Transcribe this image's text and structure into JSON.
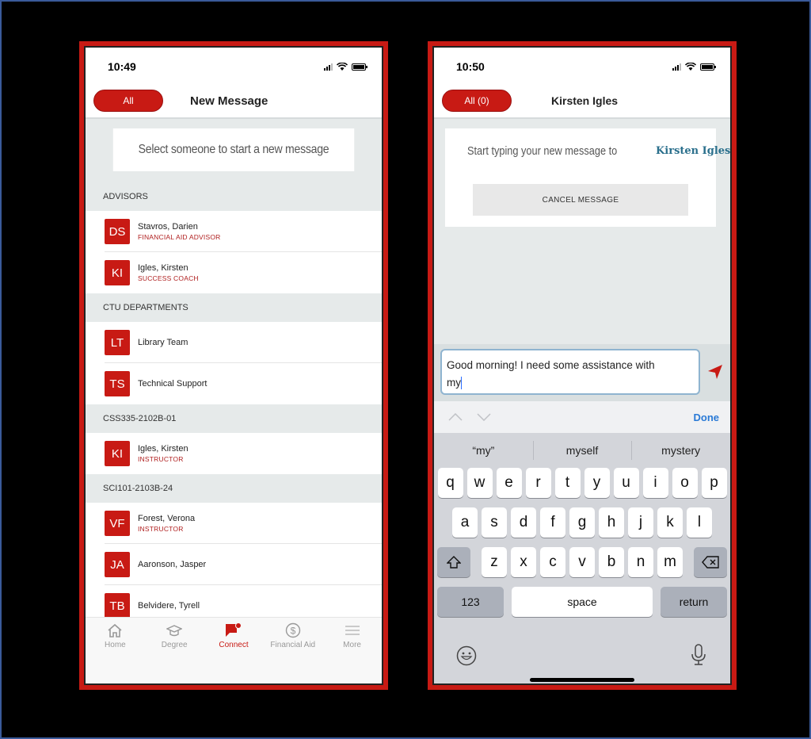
{
  "left_screen": {
    "status": {
      "time": "10:49"
    },
    "header": {
      "pill_label": "All",
      "title": "New Message"
    },
    "prompt": "Select someone to start a new message",
    "sections": [
      {
        "title": "ADVISORS",
        "contacts": [
          {
            "initials": "DS",
            "name": "Stavros, Darien",
            "role": "FINANCIAL AID ADVISOR"
          },
          {
            "initials": "KI",
            "name": "Igles, Kirsten",
            "role": "SUCCESS COACH"
          }
        ]
      },
      {
        "title": "CTU DEPARTMENTS",
        "contacts": [
          {
            "initials": "LT",
            "name": "Library Team",
            "role": ""
          },
          {
            "initials": "TS",
            "name": "Technical Support",
            "role": ""
          }
        ]
      },
      {
        "title": "CSS335-2102B-01",
        "contacts": [
          {
            "initials": "KI",
            "name": "Igles, Kirsten",
            "role": "INSTRUCTOR"
          }
        ]
      },
      {
        "title": "SCI101-2103B-24",
        "contacts": [
          {
            "initials": "VF",
            "name": "Forest, Verona",
            "role": "INSTRUCTOR"
          },
          {
            "initials": "JA",
            "name": "Aaronson, Jasper",
            "role": ""
          },
          {
            "initials": "TB",
            "name": "Belvidere, Tyrell",
            "role": ""
          }
        ]
      }
    ],
    "tabs": [
      {
        "label": "Home",
        "icon": "home-icon"
      },
      {
        "label": "Degree",
        "icon": "graduation-cap-icon"
      },
      {
        "label": "Connect",
        "icon": "chat-flag-icon",
        "active": true
      },
      {
        "label": "Financial Aid",
        "icon": "dollar-circle-icon"
      },
      {
        "label": "More",
        "icon": "menu-icon"
      }
    ]
  },
  "right_screen": {
    "status": {
      "time": "10:50"
    },
    "header": {
      "pill_label": "All (0)",
      "title": "Kirsten Igles"
    },
    "prompt_prefix": "Start typing your new message to",
    "recipient": "Kirsten Igles",
    "cancel_label": "CANCEL MESSAGE",
    "compose": {
      "line1": "Good morning! I need some assistance with",
      "line2": "my"
    },
    "toolbar": {
      "done_label": "Done"
    },
    "suggestions": [
      "“my”",
      "myself",
      "mystery"
    ],
    "keys": {
      "row1": [
        "q",
        "w",
        "e",
        "r",
        "t",
        "y",
        "u",
        "i",
        "o",
        "p"
      ],
      "row2": [
        "a",
        "s",
        "d",
        "f",
        "g",
        "h",
        "j",
        "k",
        "l"
      ],
      "row3": [
        "z",
        "x",
        "c",
        "v",
        "b",
        "n",
        "m"
      ],
      "numbers_label": "123",
      "space_label": "space",
      "return_label": "return"
    }
  },
  "colors": {
    "brand_red": "#c81a14",
    "link_blue": "#2a6f8c",
    "done_blue": "#2a7ad6"
  }
}
